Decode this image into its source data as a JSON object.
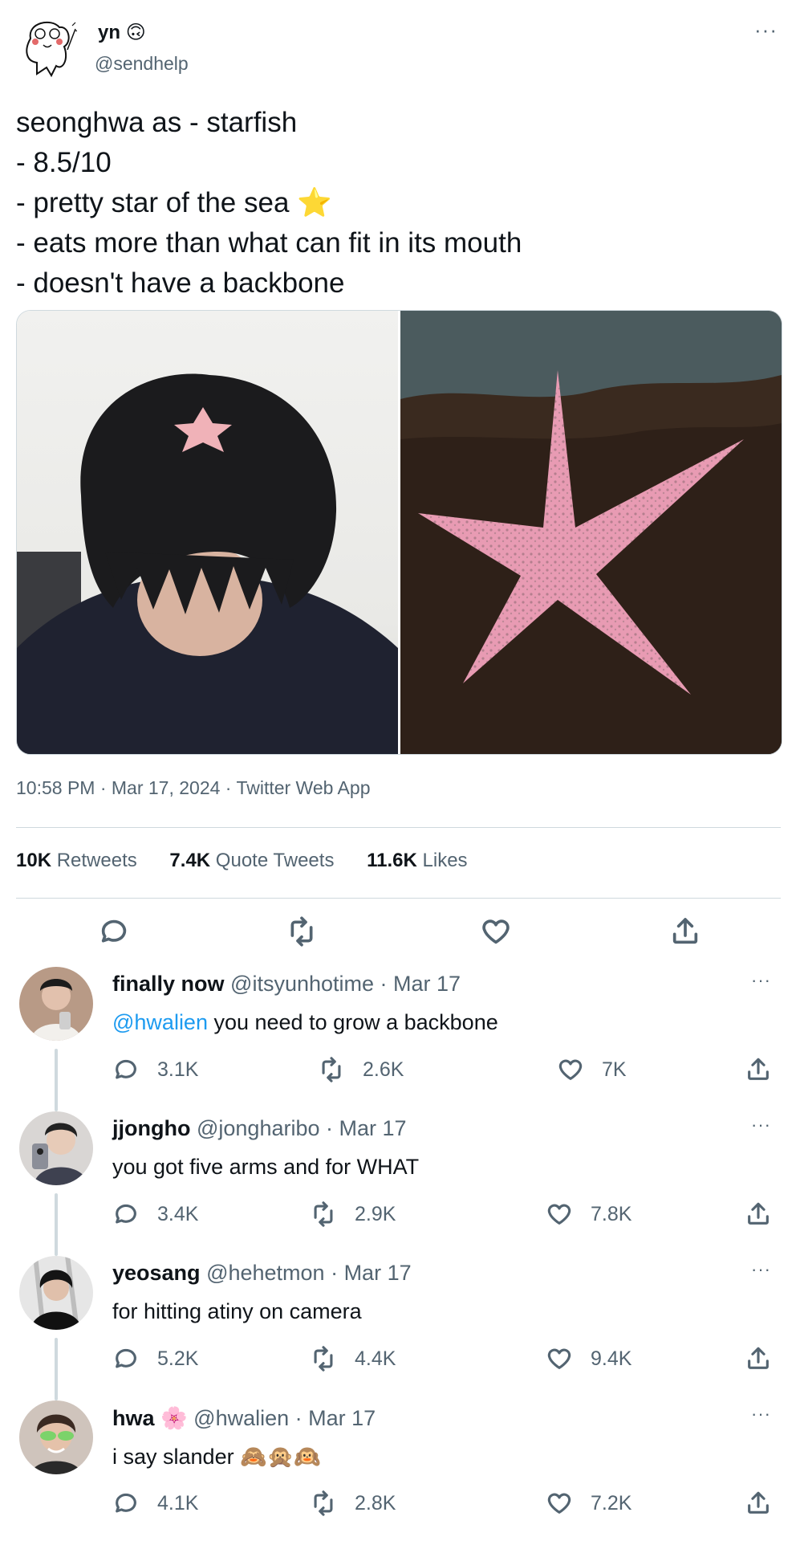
{
  "tweet": {
    "display_name": "yn",
    "name_emoji": "🙃",
    "handle": "@sendhelp",
    "more_label": "···",
    "lines": [
      "seonghwa as - starfish",
      "- 8.5/10",
      "- pretty star of the sea ⭐",
      "- eats more than what can fit in its mouth",
      "- doesn't have a backbone"
    ],
    "meta": "10:58 PM · Mar 17, 2024 · Twitter Web App",
    "stats": {
      "retweets_count": "10K",
      "retweets_label": "Retweets",
      "quotes_count": "7.4K",
      "quotes_label": "Quote Tweets",
      "likes_count": "11.6K",
      "likes_label": "Likes"
    },
    "actions": [
      "reply-icon",
      "retweet-icon",
      "like-icon",
      "share-icon"
    ]
  },
  "replies": [
    {
      "name": "finally now",
      "name_emoji": "",
      "handle": "@itsyunhotime",
      "date": "· Mar 17",
      "mention": "@hwalien",
      "text": " you need to grow a backbone",
      "replies": "3.1K",
      "retweets": "2.6K",
      "likes": "7K",
      "avatar_color": "#8a6a58"
    },
    {
      "name": "jjongho",
      "name_emoji": "",
      "handle": "@jongharibo",
      "date": "· Mar 17",
      "mention": "",
      "text": "you got five arms and for WHAT",
      "replies": "3.4K",
      "retweets": "2.9K",
      "likes": "7.8K",
      "avatar_color": "#4d4f58"
    },
    {
      "name": "yeosang",
      "name_emoji": "",
      "handle": "@hehetmon",
      "date": "· Mar 17",
      "mention": "",
      "text": "for hitting atiny on camera",
      "replies": "5.2K",
      "retweets": "4.4K",
      "likes": "9.4K",
      "avatar_color": "#2a2a2a"
    },
    {
      "name": "hwa",
      "name_emoji": "🌸",
      "handle": "@hwalien",
      "date": "· Mar 17",
      "mention": "",
      "text": "i say slander 🙈🙊🙉",
      "replies": "4.1K",
      "retweets": "2.8K",
      "likes": "7.2K",
      "avatar_color": "#6b4f43"
    }
  ],
  "colors": {
    "link": "#1d9bf0",
    "muted": "#536471",
    "divider": "#cfd9de"
  }
}
